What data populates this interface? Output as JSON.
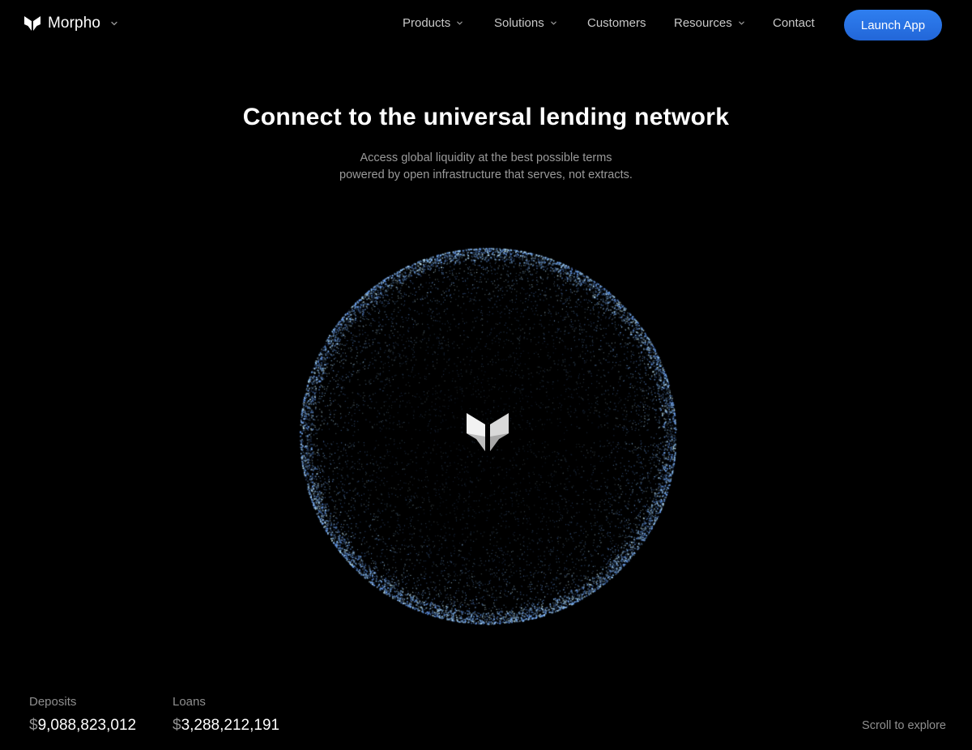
{
  "brand": {
    "name": "Morpho",
    "logo_icon": "butterfly-logo-icon"
  },
  "nav": {
    "items": [
      {
        "label": "Products",
        "has_dropdown": true
      },
      {
        "label": "Solutions",
        "has_dropdown": true
      },
      {
        "label": "Customers",
        "has_dropdown": false
      },
      {
        "label": "Resources",
        "has_dropdown": true
      },
      {
        "label": "Contact",
        "has_dropdown": false
      }
    ],
    "cta_label": "Launch App"
  },
  "hero": {
    "title": "Connect to the universal lending network",
    "subtitle_line1": "Access global liquidity at the best possible terms",
    "subtitle_line2": "powered by open infrastructure that serves, not extracts."
  },
  "stats": {
    "deposits": {
      "label": "Deposits",
      "currency": "$",
      "amount": "9,088,823,012"
    },
    "loans": {
      "label": "Loans",
      "currency": "$",
      "amount": "3,288,212,191"
    }
  },
  "scroll_hint": "Scroll to explore",
  "colors": {
    "background": "#000000",
    "accent": "#2a72e6",
    "globe_particles": [
      "#8fc8ff",
      "#6fa6ff",
      "#c9f0ff",
      "#5a8fe0"
    ]
  }
}
